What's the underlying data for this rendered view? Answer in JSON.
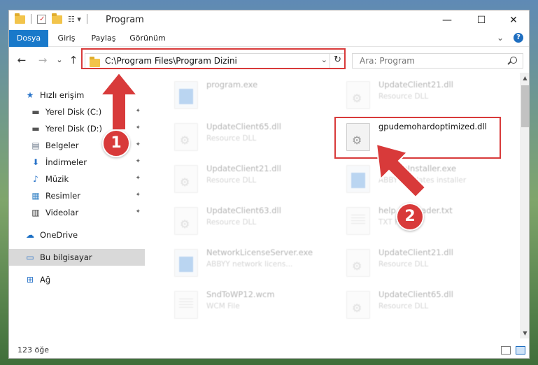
{
  "window": {
    "title": "Program",
    "controls": {
      "minimize": "—",
      "maximize": "☐",
      "close": "✕"
    }
  },
  "ribbon": {
    "tabs": [
      {
        "label": "Dosya",
        "active": true
      },
      {
        "label": "Giriş",
        "active": false
      },
      {
        "label": "Paylaş",
        "active": false
      },
      {
        "label": "Görünüm",
        "active": false
      }
    ],
    "expand_glyph": "⌄",
    "help_glyph": "?"
  },
  "nav": {
    "back": "←",
    "forward": "→",
    "recent": "⌄",
    "up": "↑",
    "address": "C:\\Program Files\\Program Dizini",
    "refresh": "↻",
    "dropdown": "⌄",
    "search_placeholder": "Ara: Program"
  },
  "sidebar": {
    "items": [
      {
        "label": "Hızlı erişim",
        "icon": "star-icon",
        "glyph": "★",
        "color": "#2a74c9",
        "pinned": false
      },
      {
        "label": "Yerel Disk (C:)",
        "icon": "drive-icon",
        "glyph": "▬",
        "color": "#555555",
        "pinned": true
      },
      {
        "label": "Yerel Disk (D:)",
        "icon": "drive-icon",
        "glyph": "▬",
        "color": "#555555",
        "pinned": true
      },
      {
        "label": "Belgeler",
        "icon": "documents-icon",
        "glyph": "▤",
        "color": "#6c7a8a",
        "pinned": true
      },
      {
        "label": "İndirmeler",
        "icon": "download-icon",
        "glyph": "⬇",
        "color": "#2a74c9",
        "pinned": true
      },
      {
        "label": "Müzik",
        "icon": "music-icon",
        "glyph": "♪",
        "color": "#2a74c9",
        "pinned": true
      },
      {
        "label": "Resimler",
        "icon": "pictures-icon",
        "glyph": "▦",
        "color": "#3d87c7",
        "pinned": true
      },
      {
        "label": "Videolar",
        "icon": "video-icon",
        "glyph": "▥",
        "color": "#333333",
        "pinned": true
      },
      {
        "label": "OneDrive",
        "icon": "cloud-icon",
        "glyph": "☁",
        "color": "#1b6fc4",
        "pinned": false
      },
      {
        "label": "Bu bilgisayar",
        "icon": "computer-icon",
        "glyph": "▭",
        "color": "#2a74c9",
        "pinned": false,
        "selected": true
      },
      {
        "label": "Ağ",
        "icon": "network-icon",
        "glyph": "⊞",
        "color": "#2a74c9",
        "pinned": false
      }
    ],
    "pin_glyph": "📌"
  },
  "files": [
    {
      "name": "program.exe",
      "desc": "",
      "icon": "app",
      "blurred": true
    },
    {
      "name": "UpdateClient21.dll",
      "desc": "Resource DLL",
      "icon": "gear",
      "blurred": true
    },
    {
      "name": "UpdateClient65.dll",
      "desc": "Resource DLL",
      "icon": "gear",
      "blurred": true
    },
    {
      "name": "gpudemohardoptimized.dll",
      "desc": "",
      "icon": "gear",
      "blurred": false
    },
    {
      "name": "UpdateClient21.dll",
      "desc": "Resource DLL",
      "icon": "gear",
      "blurred": true
    },
    {
      "name": "UpdateInstaller.exe",
      "desc": "ABBYY updates installer",
      "icon": "app",
      "blurred": true
    },
    {
      "name": "UpdateClient63.dll",
      "desc": "Resource DLL",
      "icon": "gear",
      "blurred": true
    },
    {
      "name": "help file reader.txt",
      "desc": "TXT File",
      "icon": "txt",
      "blurred": true
    },
    {
      "name": "NetworkLicenseServer.exe",
      "desc": "ABBYY network licens...",
      "icon": "app",
      "blurred": true
    },
    {
      "name": "UpdateClient21.dll",
      "desc": "Resource DLL",
      "icon": "gear",
      "blurred": true
    },
    {
      "name": "SndToWP12.wcm",
      "desc": "WCM File",
      "icon": "txt",
      "blurred": true
    },
    {
      "name": "UpdateClient65.dll",
      "desc": "Resource DLL",
      "icon": "gear",
      "blurred": true
    }
  ],
  "status": {
    "count": "123 öğe"
  },
  "annotations": {
    "callout1": "1",
    "callout2": "2",
    "color": "#d83a3a"
  }
}
